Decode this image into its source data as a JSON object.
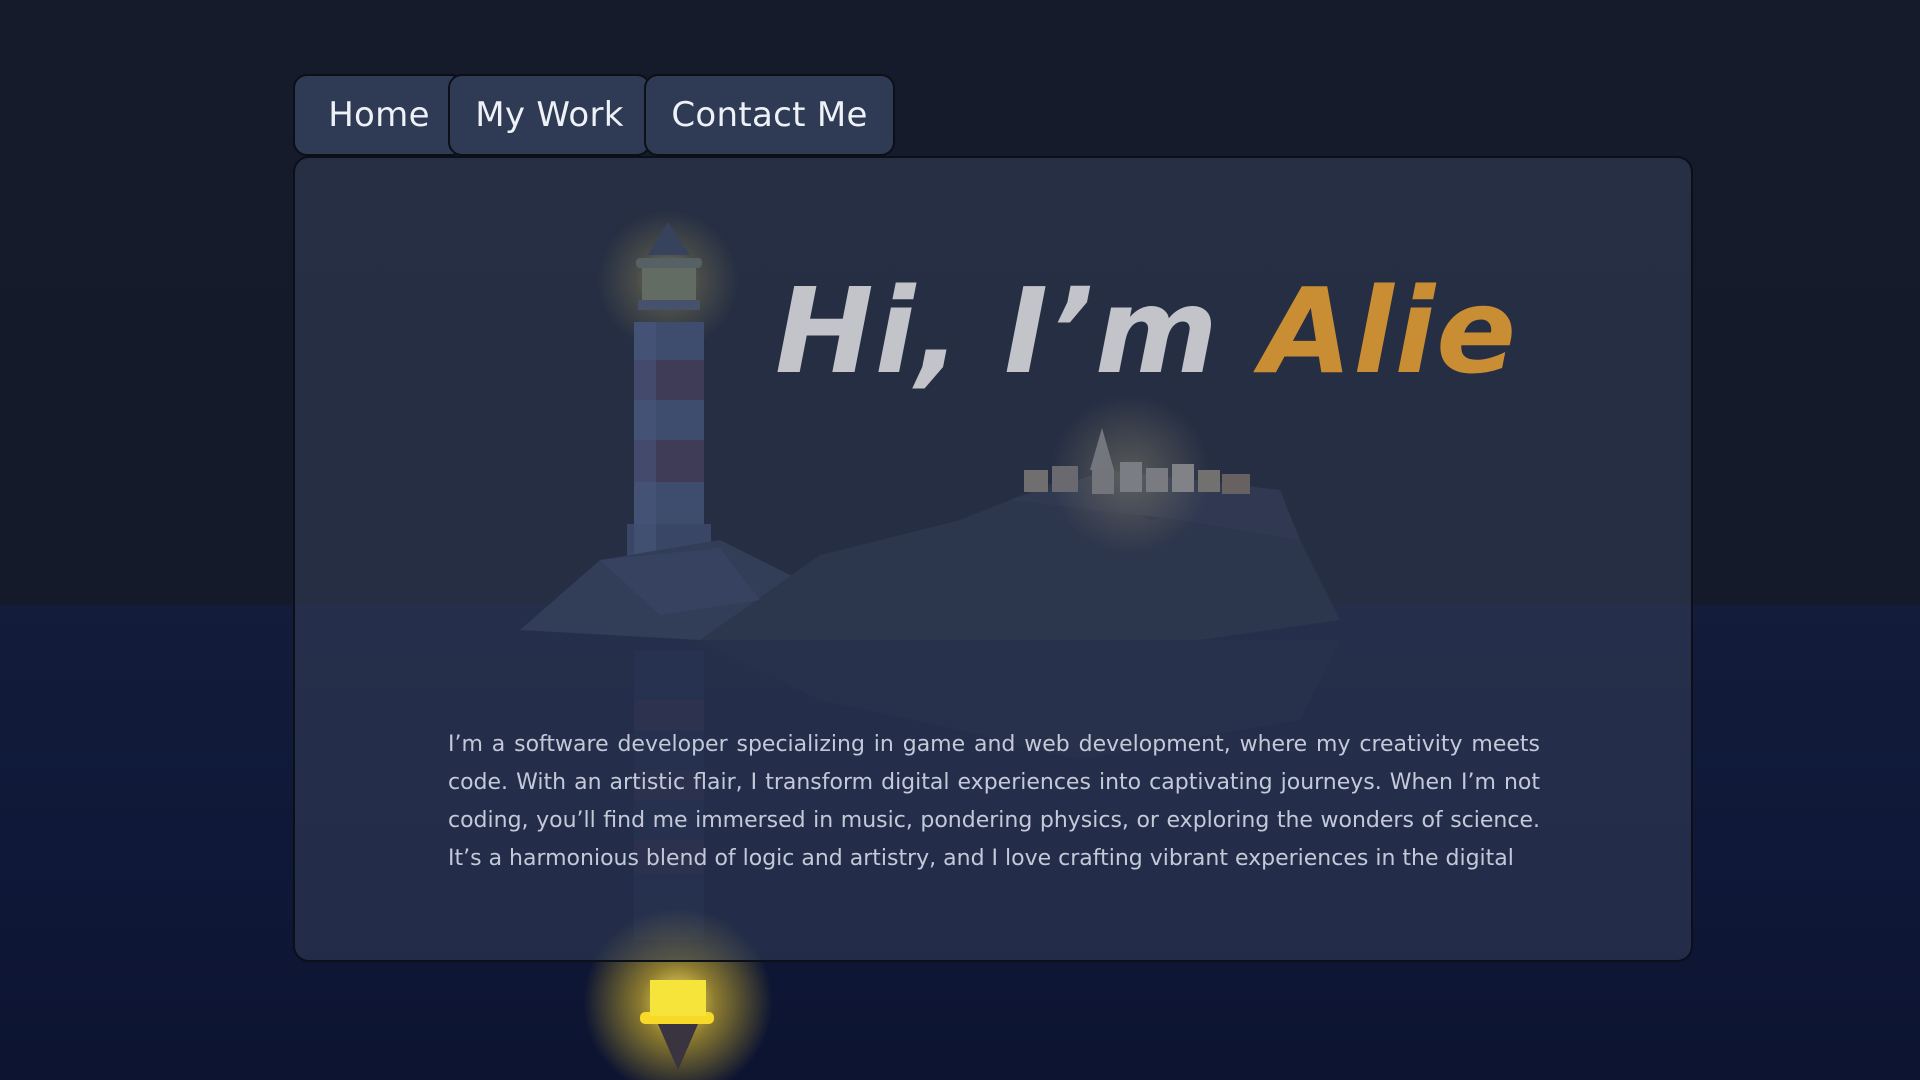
{
  "nav": {
    "tabs": [
      {
        "label": "Home"
      },
      {
        "label": "My Work"
      },
      {
        "label": "Contact Me"
      }
    ]
  },
  "hero": {
    "greeting": "Hi, I’m",
    "name": "Alie",
    "bio": "I’m a software developer specializing in game and web development, where my creativity meets code. With an artistic flair, I transform digital experiences into captivating journeys. When I’m not coding, you’ll find me immersed in music, pondering physics, or exploring the wonders of science. It’s a harmonious blend of logic and artistry, and I love crafting vibrant experiences in the digital"
  },
  "colors": {
    "accent": "#c98d33",
    "panel": "#343f5a",
    "tab": "#2f3b55",
    "background": "#141a29",
    "lighthouse_light": "#f5e04a"
  }
}
